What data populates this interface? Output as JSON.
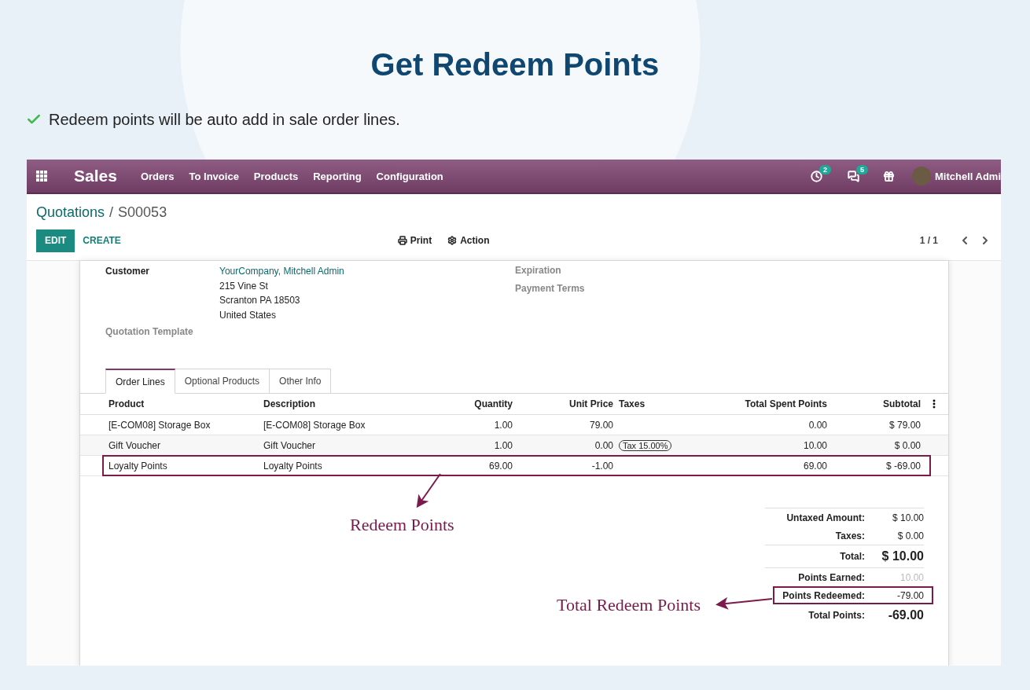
{
  "heading": "Get Redeem Points",
  "feature_note": "Redeem points will be auto add in sale order lines.",
  "navbar": {
    "app_name": "Sales",
    "menu": [
      "Orders",
      "To Invoice",
      "Products",
      "Reporting",
      "Configuration"
    ],
    "activity_count": "2",
    "message_count": "5",
    "user": "Mitchell Admi"
  },
  "breadcrumb": {
    "parent": "Quotations",
    "separator": "/",
    "current": "S00053"
  },
  "buttons": {
    "edit": "EDIT",
    "create": "CREATE",
    "print": "Print",
    "action": "Action"
  },
  "pager": "1 / 1",
  "form": {
    "customer_label": "Customer",
    "customer_name": "YourCompany, Mitchell Admin",
    "address": [
      "215 Vine St",
      "Scranton PA 18503",
      "United States"
    ],
    "template_label": "Quotation Template",
    "right_labels": [
      "Expiration",
      "Payment Terms"
    ]
  },
  "tabs": [
    {
      "label": "Order Lines",
      "selected": true
    },
    {
      "label": "Optional Products",
      "selected": false
    },
    {
      "label": "Other Info",
      "selected": false
    }
  ],
  "table": {
    "columns": [
      "Product",
      "Description",
      "Quantity",
      "Unit Price",
      "Taxes",
      "Total Spent Points",
      "Subtotal"
    ],
    "rows": [
      {
        "cells": [
          "[E-COM08] Storage Box",
          "[E-COM08] Storage Box",
          "1.00",
          "79.00",
          "",
          "0.00",
          "$ 79.00"
        ],
        "highlighted": false
      },
      {
        "cells": [
          "Gift Voucher",
          "Gift Voucher",
          "1.00",
          "0.00",
          "Tax 15.00%",
          "10.00",
          "$ 0.00"
        ],
        "highlighted": false
      },
      {
        "cells": [
          "Loyalty Points",
          "Loyalty Points",
          "69.00",
          "-1.00",
          "",
          "69.00",
          "$ -69.00"
        ],
        "highlighted": true
      }
    ]
  },
  "totals": [
    {
      "label": "Untaxed Amount:",
      "value": "$ 10.00",
      "kind": "normal",
      "highlighted": false
    },
    {
      "label": "Taxes:",
      "value": "$ 0.00",
      "kind": "normal",
      "highlighted": false
    },
    {
      "label": "Total:",
      "value": "$ 10.00",
      "kind": "grand",
      "highlighted": false
    },
    {
      "label": "Points Earned:",
      "value": "10.00",
      "kind": "muted",
      "highlighted": false
    },
    {
      "label": "Points Redeemed:",
      "value": "-79.00",
      "kind": "normal",
      "highlighted": true
    },
    {
      "label": "Total Points:",
      "value": "-69.00",
      "kind": "grand",
      "highlighted": false
    }
  ],
  "annotations": [
    "Redeem Points",
    "Total Redeem Points"
  ]
}
